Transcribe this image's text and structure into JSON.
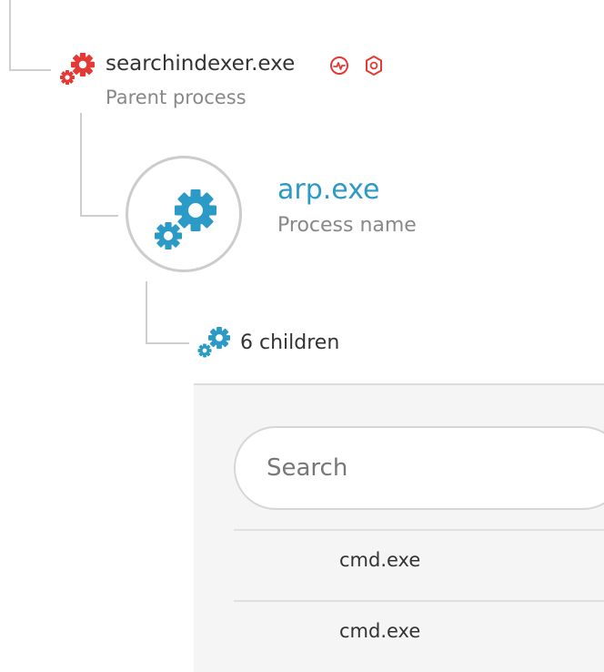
{
  "colors": {
    "parent_accent": "#e53935",
    "process_accent": "#2b9ac6",
    "connector": "#cfcfcf",
    "panel_background": "#f5f5f5"
  },
  "parent": {
    "icon": "gears-icon",
    "name": "searchindexer.exe",
    "caption": "Parent process",
    "badges": [
      "activity-icon",
      "shield-icon"
    ]
  },
  "process": {
    "icon": "gears-icon",
    "name": "arp.exe",
    "caption": "Process name"
  },
  "children": {
    "icon": "gears-icon",
    "label": "6 children",
    "search_placeholder": "Search",
    "items": [
      {
        "name": "cmd.exe"
      },
      {
        "name": "cmd.exe"
      }
    ]
  }
}
